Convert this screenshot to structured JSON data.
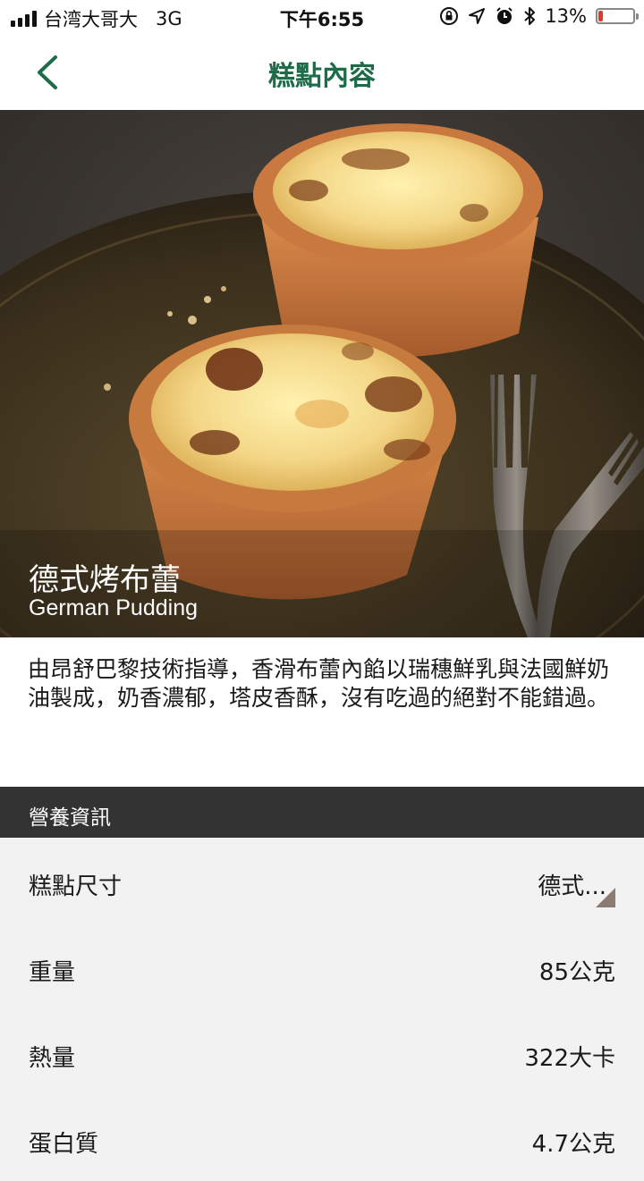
{
  "status_bar": {
    "carrier": "台湾大哥大",
    "network": "3G",
    "time": "下午6:55",
    "battery": "13%",
    "battery_level": 0.13,
    "icons": [
      "signal-icon",
      "orientation-lock-icon",
      "location-icon",
      "alarm-icon",
      "bluetooth-icon",
      "battery-icon"
    ]
  },
  "nav": {
    "title": "糕點內容",
    "back_icon": "chevron-left-icon",
    "accent_color": "#1e6b48"
  },
  "hero": {
    "name_zh": "德式烤布蕾",
    "name_en": "German Pudding"
  },
  "description": "由昂舒巴黎技術指導，香滑布蕾內餡以瑞穗鮮乳與法國鮮奶油製成，奶香濃郁，塔皮香酥，沒有吃過的絕對不能錯過。",
  "nutrition": {
    "header": "營養資訊",
    "size": {
      "label": "糕點尺寸",
      "value": "德式..."
    },
    "rows": [
      {
        "label": "重量",
        "value": "85公克"
      },
      {
        "label": "熱量",
        "value": "322大卡"
      },
      {
        "label": "蛋白質",
        "value": "4.7公克"
      }
    ]
  }
}
